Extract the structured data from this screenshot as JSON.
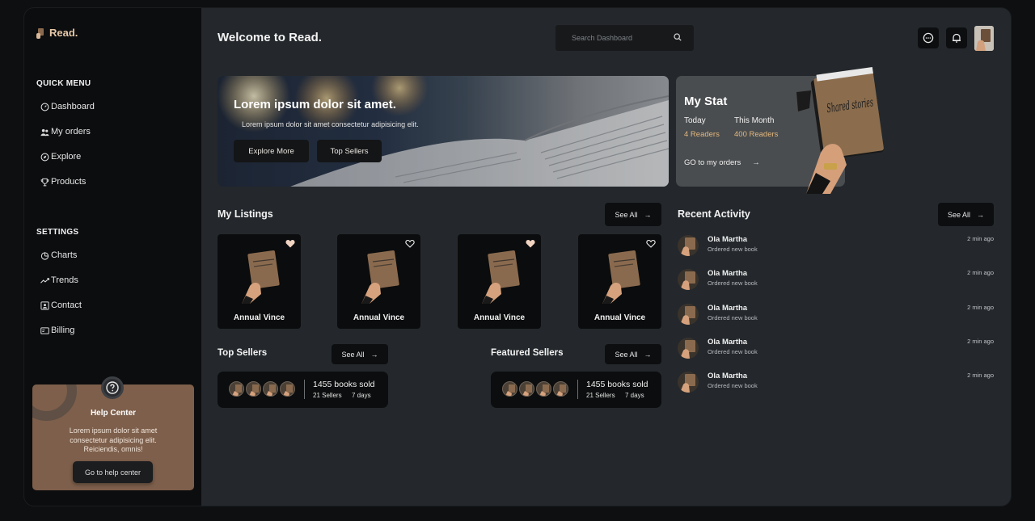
{
  "brand": {
    "name": "Read."
  },
  "sidebar": {
    "quick_menu_title": "QUICK MENU",
    "quick_menu": [
      {
        "label": "Dashboard",
        "icon": "dashboard-icon"
      },
      {
        "label": "My orders",
        "icon": "users-icon"
      },
      {
        "label": "Explore",
        "icon": "compass-icon"
      },
      {
        "label": "Products",
        "icon": "trophy-icon"
      }
    ],
    "settings_title": "SETTINGS",
    "settings": [
      {
        "label": "Charts",
        "icon": "pie-chart-icon"
      },
      {
        "label": "Trends",
        "icon": "trend-icon"
      },
      {
        "label": "Contact",
        "icon": "contact-icon"
      },
      {
        "label": "Billing",
        "icon": "billing-icon"
      }
    ]
  },
  "help": {
    "title": "Help Center",
    "text": "Lorem ipsum dolor sit amet consectetur adipisicing elit. Reiciendis, omnis!",
    "button": "Go to help center"
  },
  "header": {
    "title": "Welcome to Read.",
    "search_placeholder": "Search Dashboard"
  },
  "hero": {
    "title": "Lorem ipsum dolor sit amet.",
    "subtitle": "Lorem ipsum dolor sit amet consectetur adipisicing elit.",
    "btn_explore": "Explore More",
    "btn_sellers": "Top Sellers"
  },
  "stat": {
    "title": "My Stat",
    "today_label": "Today",
    "today_value": "4 Readers",
    "month_label": "This Month",
    "month_value": "400 Readers",
    "link": "GO to my orders",
    "book_title": "Shared stories"
  },
  "listings": {
    "title": "My Listings",
    "see_all": "See All",
    "items": [
      {
        "name": "Annual Vince"
      },
      {
        "name": "Annual Vince"
      },
      {
        "name": "Annual Vince"
      },
      {
        "name": "Annual Vince"
      }
    ]
  },
  "activity": {
    "title": "Recent Activity",
    "see_all": "See All",
    "items": [
      {
        "name": "Ola Martha",
        "desc": "Ordered new book",
        "time": "2 min ago"
      },
      {
        "name": "Ola Martha",
        "desc": "Ordered new book",
        "time": "2 min ago"
      },
      {
        "name": "Ola Martha",
        "desc": "Ordered new book",
        "time": "2 min ago"
      },
      {
        "name": "Ola Martha",
        "desc": "Ordered new book",
        "time": "2 min ago"
      },
      {
        "name": "Ola Martha",
        "desc": "Ordered new book",
        "time": "2 min ago"
      }
    ]
  },
  "top_sellers": {
    "title": "Top Sellers",
    "see_all": "See All",
    "books_sold": "1455 books sold",
    "sellers": "21 Sellers",
    "days": "7 days"
  },
  "featured_sellers": {
    "title": "Featured Sellers",
    "see_all": "See All",
    "books_sold": "1455 books sold",
    "sellers": "21 Sellers",
    "days": "7 days"
  },
  "colors": {
    "accent": "#e3b77e",
    "panel": "#24282c",
    "sidebar": "#0c0d0f",
    "help_bg": "#7d5f4b"
  }
}
